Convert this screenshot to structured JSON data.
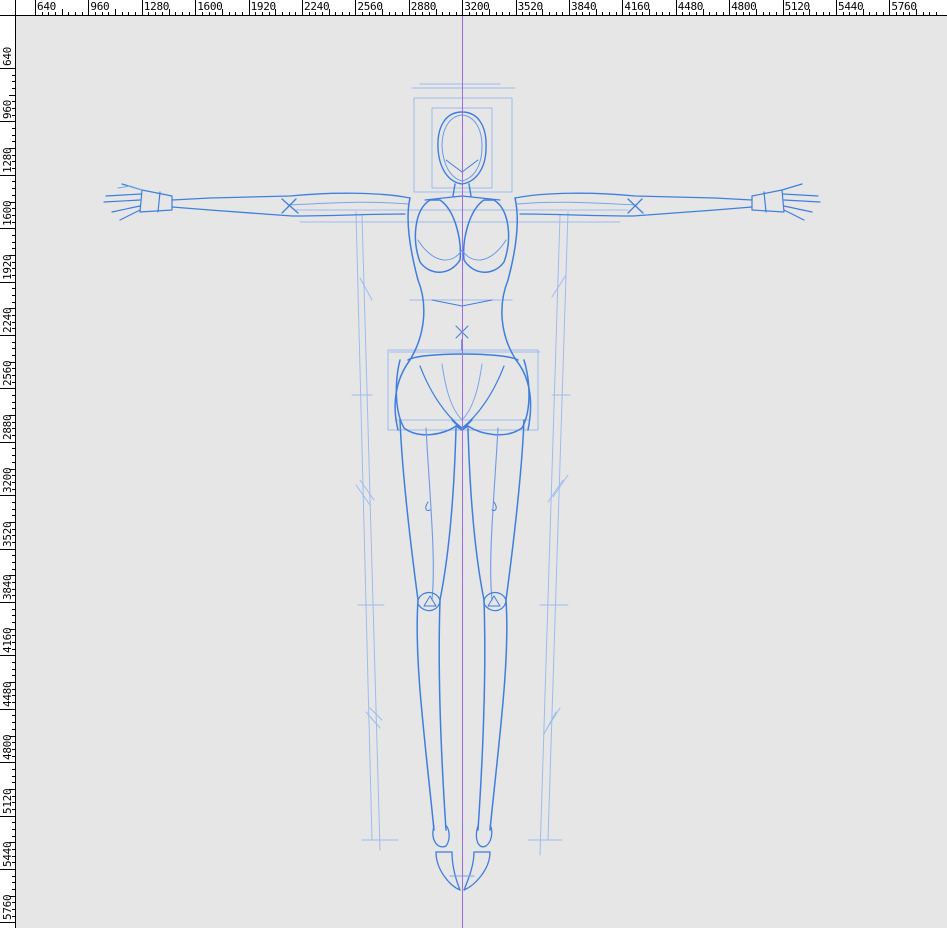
{
  "ruler": {
    "top_labels": [
      "640",
      "960",
      "1280",
      "1600",
      "1920",
      "2240",
      "2560",
      "2880",
      "3200",
      "3520",
      "3840",
      "4160",
      "4480",
      "4800",
      "5120",
      "5440",
      "5760"
    ],
    "left_labels": [
      "640",
      "960",
      "1280",
      "1600",
      "1920",
      "2240",
      "2560",
      "2880",
      "3200",
      "3520",
      "3840",
      "4160",
      "4480",
      "4800",
      "5120",
      "5440",
      "5760"
    ]
  },
  "colors": {
    "canvas_background": "#e6e6e6",
    "ruler_background": "#ffffff",
    "sketch_stroke": "#3f7ee0",
    "sketch_light": "#8fb2ea",
    "guide_line": "#9a6ee8"
  },
  "icons": {
    "guide": "vertical-guide-line",
    "sketch": "figure-sketch"
  }
}
